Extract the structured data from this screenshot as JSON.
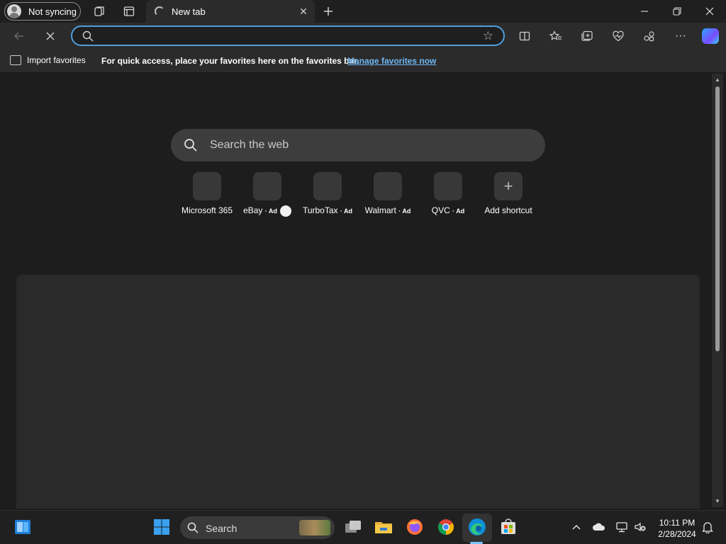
{
  "titlebar": {
    "profile_label": "Not syncing",
    "tab_title": "New tab",
    "icons": [
      "workspaces-icon",
      "tab-actions-icon",
      "new-tab-icon",
      "minimize-icon",
      "restore-icon",
      "close-icon"
    ]
  },
  "toolbar": {
    "address_value": "",
    "icons": [
      "back-icon",
      "stop-loading-icon",
      "search-icon",
      "favorite-star-icon",
      "split-screen-icon",
      "favorites-icon",
      "collections-icon",
      "browser-essentials-icon",
      "extensions-icon",
      "more-icon",
      "copilot-icon"
    ]
  },
  "favorites_bar": {
    "import_label": "Import favorites",
    "message": "For quick access, place your favorites here on the favorites bar.",
    "manage_link": "Manage favorites now"
  },
  "newtab": {
    "search_placeholder": "Search the web",
    "shortcuts": [
      {
        "name": "Microsoft 365",
        "ad": ""
      },
      {
        "name": "eBay",
        "ad": "· Ad"
      },
      {
        "name": "TurboTax",
        "ad": "· Ad"
      },
      {
        "name": "Walmart",
        "ad": "· Ad"
      },
      {
        "name": "QVC",
        "ad": "· Ad"
      },
      {
        "name": "Add shortcut",
        "ad": ""
      }
    ]
  },
  "taskbar": {
    "search_label": "Search",
    "time": "10:11 PM",
    "date": "2/28/2024",
    "apps": [
      "widgets-icon",
      "start-icon",
      "task-view-icon",
      "file-explorer-icon",
      "firefox-icon",
      "chrome-icon",
      "edge-icon",
      "store-icon"
    ],
    "tray": [
      "chevron-up-icon",
      "onedrive-icon",
      "network-icon",
      "volume-muted-icon",
      "notifications-icon"
    ]
  },
  "colors": {
    "accent": "#4e9edc",
    "link": "#6cb8f6"
  }
}
